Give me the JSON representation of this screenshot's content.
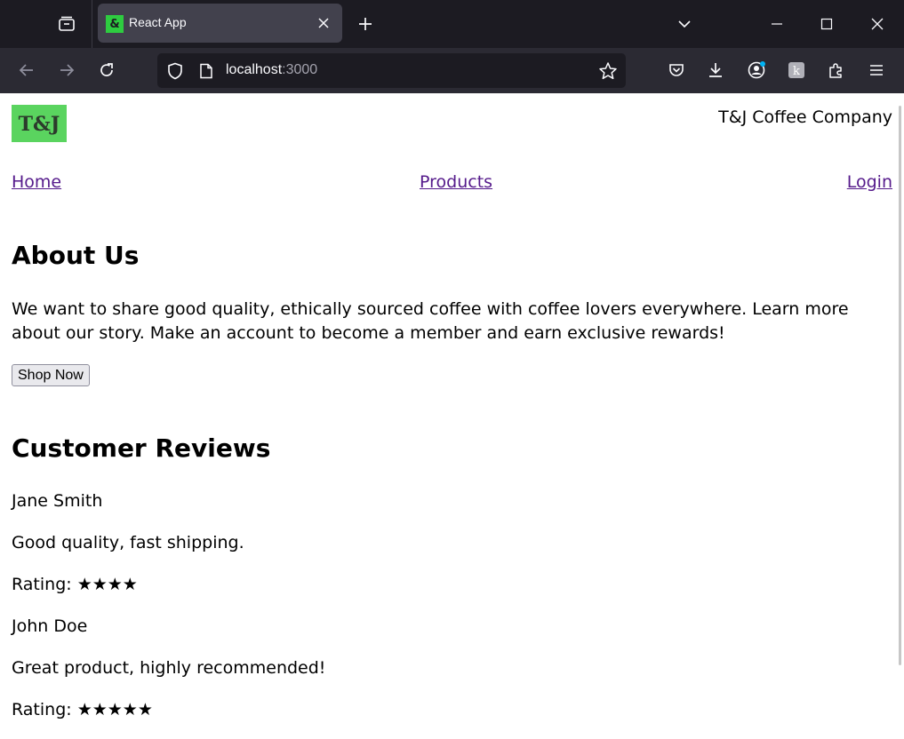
{
  "browser": {
    "tab_title": "React App",
    "favicon_glyph": "&",
    "url_host": "localhost",
    "url_port": ":3000"
  },
  "page": {
    "company_name": "T&J Coffee Company",
    "logo_text": "T&J",
    "nav": [
      "Home",
      "Products",
      "Login"
    ],
    "about_heading": "About Us",
    "about_text": "We want to share good quality, ethically sourced coffee with coffee lovers everywhere. Learn more about our story. Make an account to become a member and earn exclusive rewards!",
    "shop_button": "Shop Now",
    "reviews_heading": "Customer Reviews",
    "reviews": [
      {
        "name": "Jane Smith",
        "comment": "Good quality, fast shipping.",
        "rating_label": "Rating: ★★★★",
        "stars": 4
      },
      {
        "name": "John Doe",
        "comment": "Great product, highly recommended!",
        "rating_label": "Rating: ★★★★★",
        "stars": 5
      }
    ]
  },
  "colors": {
    "chrome_dark": "#1c1b22",
    "toolbar": "#2b2a33",
    "active_tab": "#42414d",
    "logo_green": "#5ad45f",
    "visited_link": "#551a8b"
  }
}
